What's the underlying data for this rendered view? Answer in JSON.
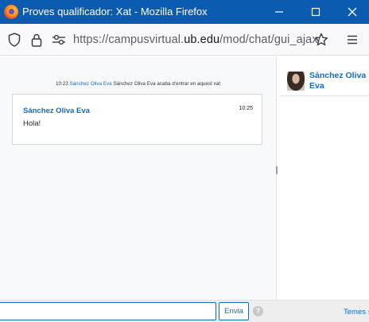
{
  "window": {
    "title": "Proves qualificador: Xat - Mozilla Firefox",
    "icons": {
      "app": "firefox-logo",
      "minimize": "minimize-icon",
      "maximize": "maximize-icon",
      "close": "close-icon"
    }
  },
  "navbar": {
    "url_prefix": "https://campusvirtual.",
    "url_domain": "ub.edu",
    "url_suffix": "/mod/chat/gui_ajax/",
    "icons": [
      "shield-icon",
      "lock-icon",
      "permissions-icon",
      "star-icon",
      "menu-icon"
    ]
  },
  "chat": {
    "system_message": {
      "time": "10:23",
      "user": "Sánchez Oliva Eva",
      "text": "Sánchez Oliva Eva acaba d'entrar en aquest xat"
    },
    "messages": [
      {
        "user": "Sánchez Oliva Eva",
        "time": "10:25",
        "text": "Hola!"
      }
    ]
  },
  "users": [
    {
      "name": "Sánchez Oliva Eva"
    }
  ],
  "input_bar": {
    "message_value": "",
    "send_label": "Envia",
    "help_label": "?",
    "themes_label": "Temes »"
  },
  "colors": {
    "titlebar": "#0b5cb1",
    "link": "#0f6cbf",
    "chat_background": "#f8f9fa"
  }
}
